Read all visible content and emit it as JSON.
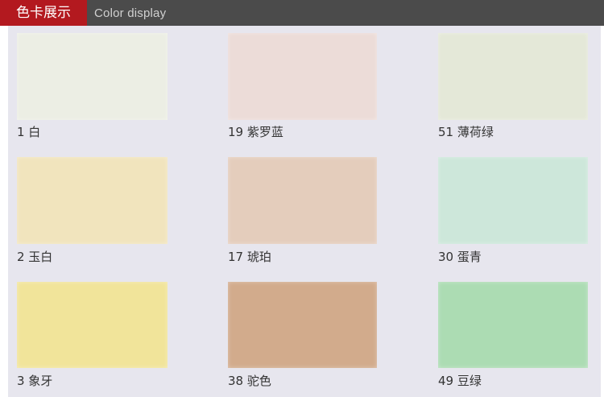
{
  "header": {
    "title": "色卡展示",
    "subtitle": "Color display"
  },
  "colors": {
    "header_bg": "#4b4b4b",
    "title_bg": "#b3191f",
    "card_bg": "#e7e6ee"
  },
  "swatches": [
    {
      "label": "1 白",
      "color": "#eceee4"
    },
    {
      "label": "19 紫罗蓝",
      "color": "#ecdcd8"
    },
    {
      "label": "51 薄荷绿",
      "color": "#e4e8d8"
    },
    {
      "label": "2 玉白",
      "color": "#f1e4bd"
    },
    {
      "label": "17 琥珀",
      "color": "#e4cdbc"
    },
    {
      "label": "30 蛋青",
      "color": "#cde7da"
    },
    {
      "label": "3 象牙",
      "color": "#f1e49a"
    },
    {
      "label": "38 驼色",
      "color": "#d2ab8c"
    },
    {
      "label": "49 豆绿",
      "color": "#acdcb3"
    }
  ]
}
